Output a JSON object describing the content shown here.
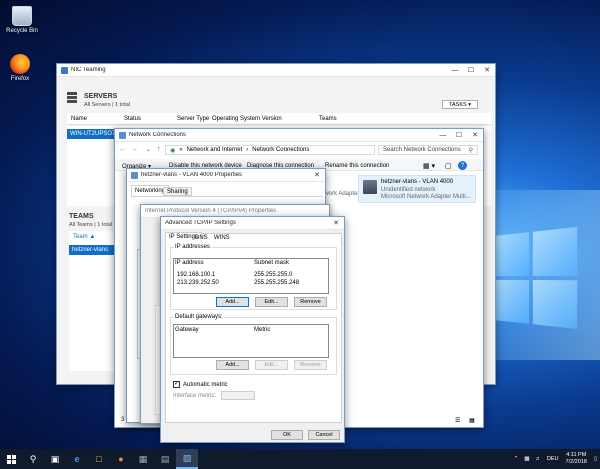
{
  "desktop": {
    "icons": [
      {
        "label": "Recycle Bin",
        "icon": "recycle-bin-icon"
      },
      {
        "label": "Firefox",
        "icon": "firefox-icon"
      }
    ]
  },
  "nic_teaming": {
    "title": "NIC Teaming",
    "servers": {
      "heading": "SERVERS",
      "subheading": "All Servers | 1 total",
      "tasks_label": "TASKS",
      "columns": [
        "Name",
        "Status",
        "Server Type",
        "Operating System Version",
        "Teams"
      ],
      "row_name": "WIN-UT2UPSO7R"
    },
    "teams": {
      "heading": "TEAMS",
      "subheading": "All Teams | 1 total",
      "column": "Team",
      "row_name": "hetzner-vlans"
    }
  },
  "network_connections": {
    "title": "Network Connections",
    "breadcrumb": [
      "Network and Internet",
      "Network Connections"
    ],
    "search_placeholder": "Search Network Connections",
    "toolbar": [
      "Organize",
      "Disable this network device",
      "Diagnose this connection",
      "Rename this connection"
    ],
    "adapter": {
      "name": "hetzner-vlans - VLAN 4000",
      "status": "Unidentified network",
      "device": "Microsoft Network Adapter Multi..."
    },
    "adapter_partial": "Network Adapter Multi...",
    "status_bar": "3 items"
  },
  "vlan_properties": {
    "title": "hetzner-vlans - VLAN 4000 Properties",
    "tabs": [
      "Networking",
      "Sharing"
    ]
  },
  "ipv4_properties": {
    "title": "Internet Protocol Version 4 (TCP/IPv4) Properties"
  },
  "advanced_tcpip": {
    "title": "Advanced TCP/IP Settings",
    "tabs": [
      "IP Settings",
      "DNS",
      "WINS"
    ],
    "ip_addresses": {
      "group_label": "IP addresses",
      "col_ip": "IP address",
      "col_mask": "Subnet mask",
      "rows": [
        {
          "ip": "192.168.100.1",
          "mask": "255.255.255.0"
        },
        {
          "ip": "213.239.252.50",
          "mask": "255.255.255.248"
        }
      ],
      "buttons": [
        "Add...",
        "Edit...",
        "Remove"
      ]
    },
    "gateways": {
      "group_label": "Default gateways:",
      "col_gateway": "Gateway",
      "col_metric": "Metric",
      "buttons": [
        "Add...",
        "Edit...",
        "Remove"
      ]
    },
    "automatic_metric_label": "Automatic metric",
    "interface_metric_label": "Interface metric:",
    "ok_label": "OK",
    "cancel_label": "Cancel"
  },
  "taskbar": {
    "language": "DEU",
    "time": "4:11 PM",
    "date": "7/2/2018"
  }
}
